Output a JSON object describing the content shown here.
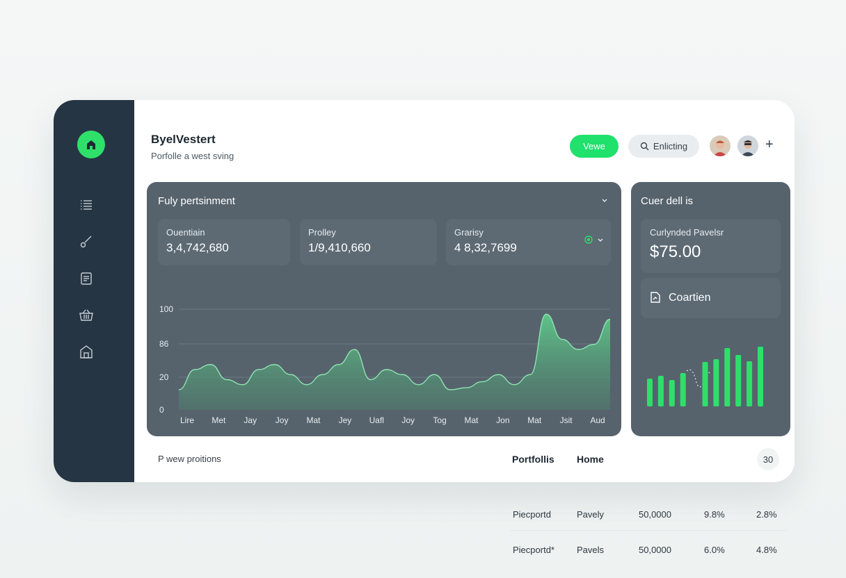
{
  "header": {
    "title": "ByelVestert",
    "subtitle": "Porfolle a west sving",
    "primary_button": "Vewe",
    "search_button": "Enlicting"
  },
  "sidebar": {
    "items": [
      {
        "icon": "list-icon"
      },
      {
        "icon": "brush-icon"
      },
      {
        "icon": "document-icon"
      },
      {
        "icon": "basket-icon"
      },
      {
        "icon": "building-icon"
      }
    ]
  },
  "main_panel": {
    "title": "Fuly pertsinment",
    "stats": [
      {
        "label": "Ouentiain",
        "value": "3,4,742,680"
      },
      {
        "label": "Prolley",
        "value": "1/9,410,660"
      },
      {
        "label": "Grarisy",
        "value": "4 8,32,7699"
      }
    ]
  },
  "chart_data": {
    "type": "area",
    "title": "",
    "xlabel": "",
    "ylabel": "",
    "y_ticks": [
      "100",
      "86",
      "20",
      "0"
    ],
    "categories": [
      "Lire",
      "Met",
      "Jay",
      "Joy",
      "Mat",
      "Jey",
      "Uafl",
      "Joy",
      "Tog",
      "Mat",
      "Jon",
      "Mat",
      "Jsit",
      "Aud"
    ],
    "series": [
      {
        "values": [
          20,
          40,
          45,
          30,
          25,
          40,
          45,
          35,
          25,
          35,
          45,
          60,
          30,
          40,
          35,
          25,
          35,
          20,
          22,
          28,
          35,
          25,
          35,
          95,
          70,
          60,
          65,
          90
        ]
      }
    ]
  },
  "side_panel": {
    "title": "Cuer dell is",
    "card_label": "Curlynded Pavelsr",
    "card_currency": "$",
    "card_value": "$75.00",
    "action_label": "Coartien",
    "bar_values": [
      40,
      44,
      38,
      48,
      28,
      64,
      68,
      84,
      74,
      65,
      86
    ]
  },
  "footer": {
    "label": "P wew proitions",
    "tabs": [
      "Portfollis",
      "Home"
    ],
    "badge": "30"
  },
  "table": {
    "rows": [
      [
        "Piecportd",
        "Pavely",
        "50,0000",
        "9.8%",
        "2.8%"
      ],
      [
        "Piecportd*",
        "Pavels",
        "50,0000",
        "6.0%",
        "4.8%"
      ]
    ]
  },
  "colors": {
    "accent": "#20e16c",
    "sidebar": "#263543",
    "panel": "#56636d"
  }
}
